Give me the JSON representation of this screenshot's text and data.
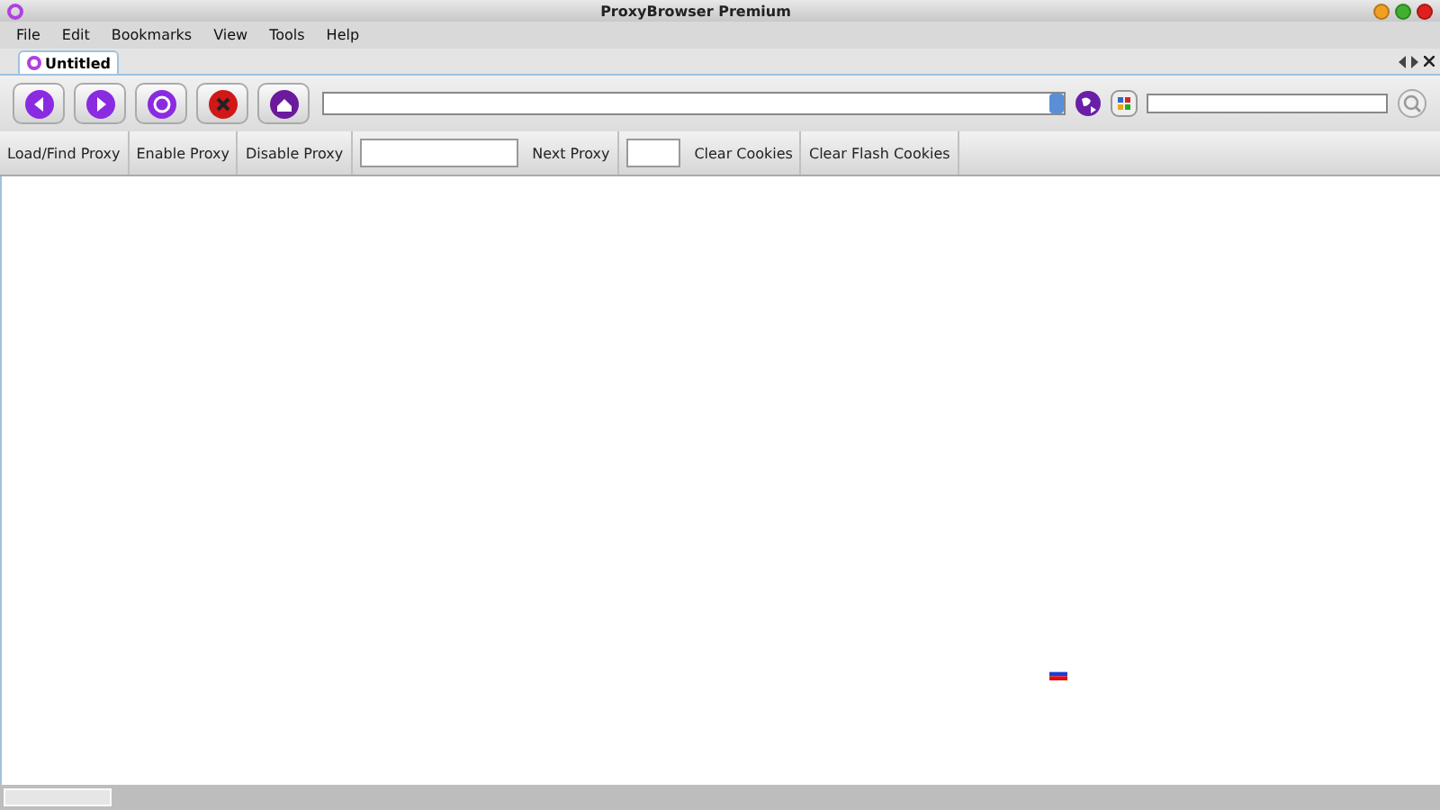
{
  "window": {
    "title": "ProxyBrowser Premium"
  },
  "menu": [
    "File",
    "Edit",
    "Bookmarks",
    "View",
    "Tools",
    "Help"
  ],
  "tabs": [
    {
      "label": "Untitled",
      "selected": true
    }
  ],
  "nav_buttons": [
    {
      "kind": "back"
    },
    {
      "kind": "forward"
    },
    {
      "kind": "reload"
    },
    {
      "kind": "stop"
    },
    {
      "kind": "home"
    }
  ],
  "proxy_bar": [
    {
      "kind": "button",
      "label": "Load/Find Proxy"
    },
    {
      "kind": "button",
      "label": "Enable Proxy"
    },
    {
      "kind": "button",
      "label": "Disable Proxy"
    },
    {
      "kind": "field"
    },
    {
      "kind": "button",
      "label": "Next Proxy"
    },
    {
      "kind": "smallfield"
    },
    {
      "kind": "button",
      "label": "Clear Cookies"
    },
    {
      "kind": "button",
      "label": "Clear Flash Cookies"
    }
  ]
}
